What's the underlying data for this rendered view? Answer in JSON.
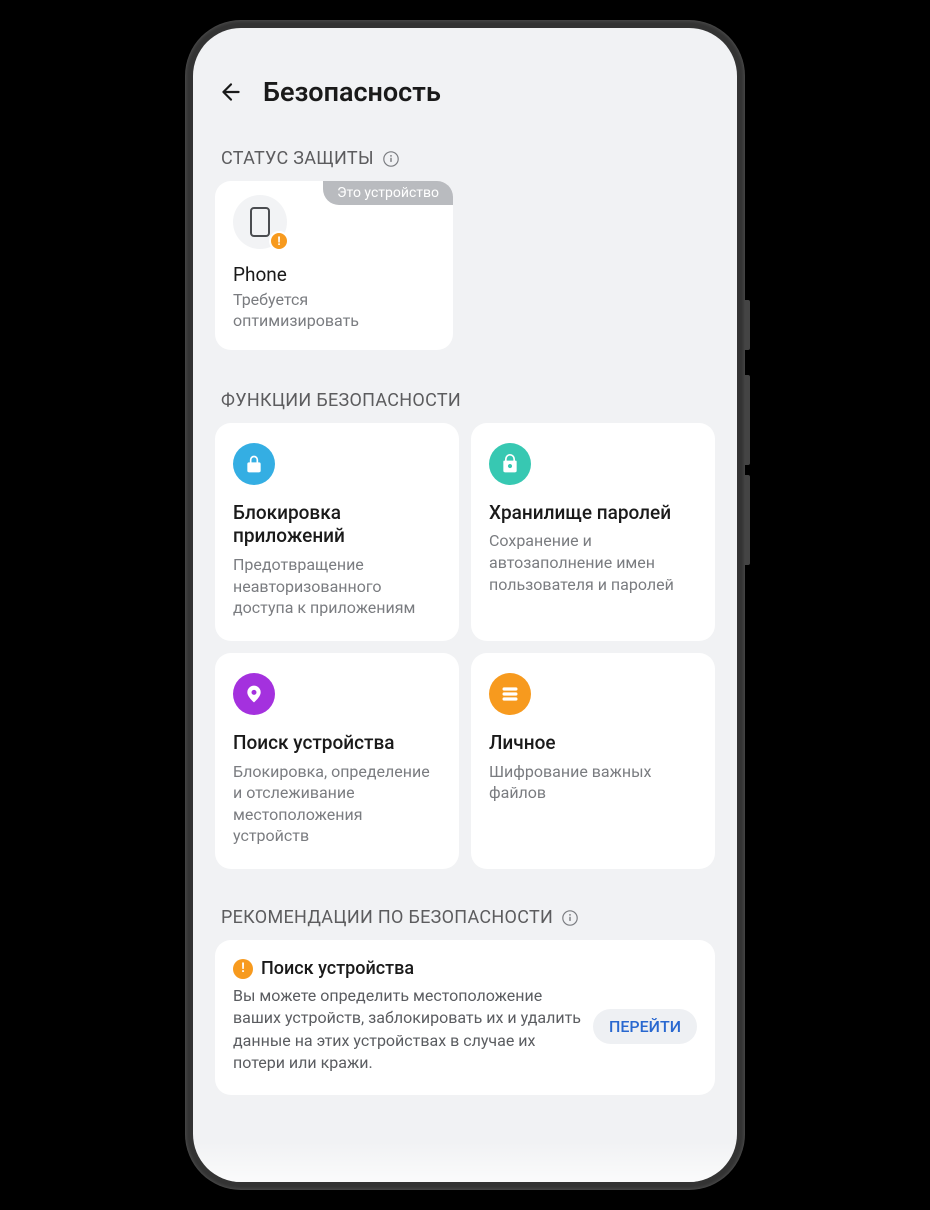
{
  "header": {
    "title": "Безопасность"
  },
  "sections": {
    "protection_status": {
      "title": "СТАТУС ЗАЩИТЫ"
    },
    "security_features": {
      "title": "ФУНКЦИИ БЕЗОПАСНОСТИ"
    },
    "recommendations": {
      "title": "РЕКОМЕНДАЦИИ ПО БЕЗОПАСНОСТИ"
    }
  },
  "device": {
    "badge": "Это устройство",
    "name": "Phone",
    "status": "Требуется оптимизировать"
  },
  "features": [
    {
      "title": "Блокировка приложений",
      "desc": "Предотвращение неавторизованного доступа к приложениям"
    },
    {
      "title": "Хранилище паролей",
      "desc": "Сохранение и автозаполнение имен пользователя и паролей"
    },
    {
      "title": "Поиск устройства",
      "desc": "Блокировка, определение и отслеживание местоположения устройств"
    },
    {
      "title": "Личное",
      "desc": "Шифрование важных файлов"
    }
  ],
  "recommendation": {
    "title": "Поиск устройства",
    "desc": "Вы можете определить местоположение ваших устройств, заблокировать их и удалить данные на этих устройствах в случае их потери или кражи.",
    "button": "ПЕРЕЙТИ"
  }
}
